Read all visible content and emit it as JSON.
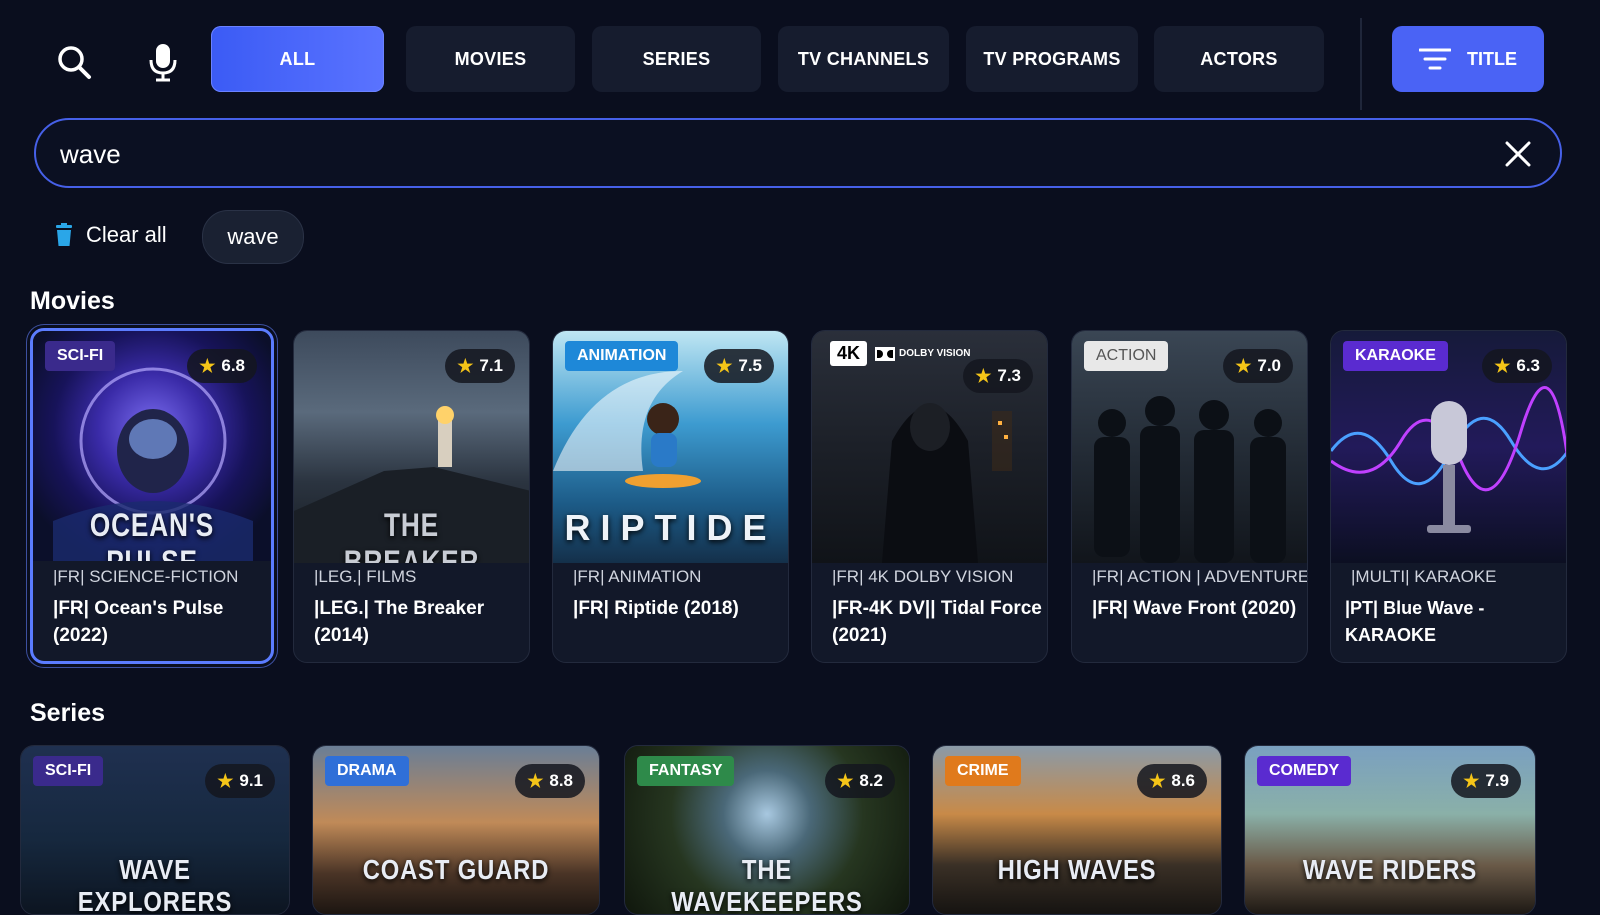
{
  "tabs": [
    {
      "label": "ALL",
      "active": true
    },
    {
      "label": "MOVIES",
      "active": false
    },
    {
      "label": "SERIES",
      "active": false
    },
    {
      "label": "TV CHANNELS",
      "active": false
    },
    {
      "label": "TV PROGRAMS",
      "active": false
    },
    {
      "label": "ACTORS",
      "active": false
    }
  ],
  "sort": {
    "label": "TITLE"
  },
  "search": {
    "value": "wave"
  },
  "history": {
    "clear_label": "Clear all",
    "chips": [
      "wave"
    ]
  },
  "accent": "#4a63f5",
  "movies": {
    "title": "Movies",
    "items": [
      {
        "badge": "SCI-FI",
        "badge_color": "#3a2a8c",
        "rating": "6.8",
        "poster_title": "OCEAN'S PULSE",
        "category": "|FR| SCIENCE-FICTION",
        "name": "|FR| Ocean's Pulse (2022)"
      },
      {
        "badge": "",
        "badge_color": "",
        "rating": "7.1",
        "poster_title": "THE BREAKER",
        "category": "|LEG.| FILMS",
        "name": "|LEG.| The Breaker (2014)"
      },
      {
        "badge": "ANIMATION",
        "badge_color": "#1e88d8",
        "rating": "7.5",
        "poster_title": "RIPTIDE",
        "category": "|FR| ANIMATION",
        "name": "|FR| Riptide (2018)"
      },
      {
        "badge": "4K",
        "badge_color": "#ffffff",
        "dolby": "DOLBY VISION",
        "rating": "7.3",
        "poster_title": "",
        "category": "|FR| 4K DOLBY VISION",
        "name": "|FR-4K DV|| Tidal Force (2021)"
      },
      {
        "badge": "ACTION",
        "badge_color": "#e8e8e8",
        "rating": "7.0",
        "poster_title": "",
        "category": "|FR| ACTION | ADVENTURE",
        "name": "|FR| Wave Front (2020)"
      },
      {
        "badge": "KARAOKE",
        "badge_color": "#5a2bd0",
        "rating": "6.3",
        "poster_title": "",
        "category": "|MULTI| KARAOKE",
        "name": "|PT| Blue Wave - KARAOKE"
      }
    ]
  },
  "series": {
    "title": "Series",
    "items": [
      {
        "badge": "SCI-FI",
        "badge_color": "#3a2a8c",
        "rating": "9.1",
        "poster_title": "WAVE EXPLORERS"
      },
      {
        "badge": "DRAMA",
        "badge_color": "#2f6fd8",
        "rating": "8.8",
        "poster_title": "COAST GUARD"
      },
      {
        "badge": "FANTASY",
        "badge_color": "#2e8a4a",
        "rating": "8.2",
        "poster_title": "THE WAVEKEEPERS"
      },
      {
        "badge": "CRIME",
        "badge_color": "#e07a1c",
        "rating": "8.6",
        "poster_title": "HIGH WAVES"
      },
      {
        "badge": "COMEDY",
        "badge_color": "#5a2bd0",
        "rating": "7.9",
        "poster_title": "WAVE RIDERS"
      }
    ]
  }
}
